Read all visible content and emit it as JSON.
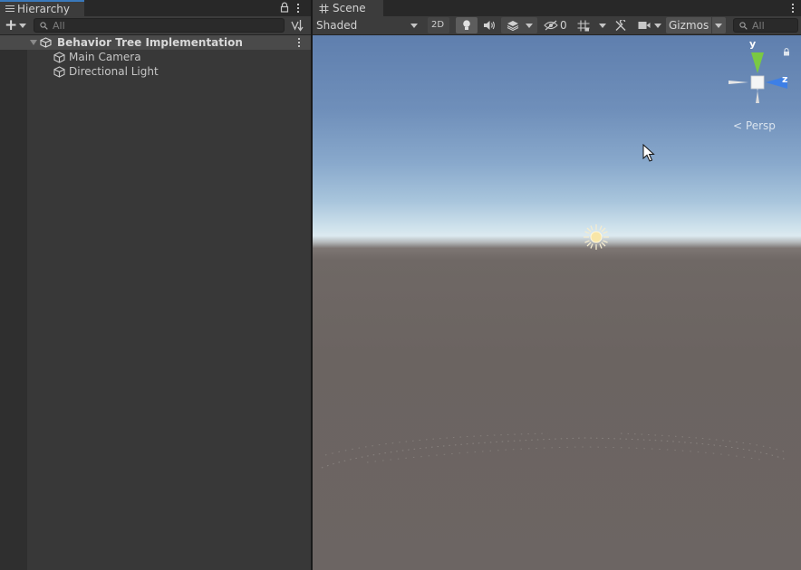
{
  "hierarchy": {
    "tab_label": "Hierarchy",
    "search_placeholder": "All",
    "scene_name": "Behavior Tree Implementation",
    "objects": [
      {
        "label": "Main Camera",
        "icon": "gameobject-cube-icon"
      },
      {
        "label": "Directional Light",
        "icon": "gameobject-cube-icon"
      }
    ]
  },
  "scene": {
    "tab_label": "Scene",
    "draw_mode": "Shaded",
    "mode_2d": "2D",
    "hidden_count": "0",
    "gizmos_label": "Gizmos",
    "search_placeholder": "All",
    "projection_label": "Persp",
    "axis_labels": {
      "y": "y",
      "z": "z"
    }
  },
  "colors": {
    "panel_bg": "#383838",
    "toolbar_bg": "#3c3c3c",
    "active_tab_accent": "#3a79bb",
    "selected_row": "#4a4a4a",
    "gizmo_y": "#7ac943",
    "gizmo_z": "#3d7fe6"
  }
}
